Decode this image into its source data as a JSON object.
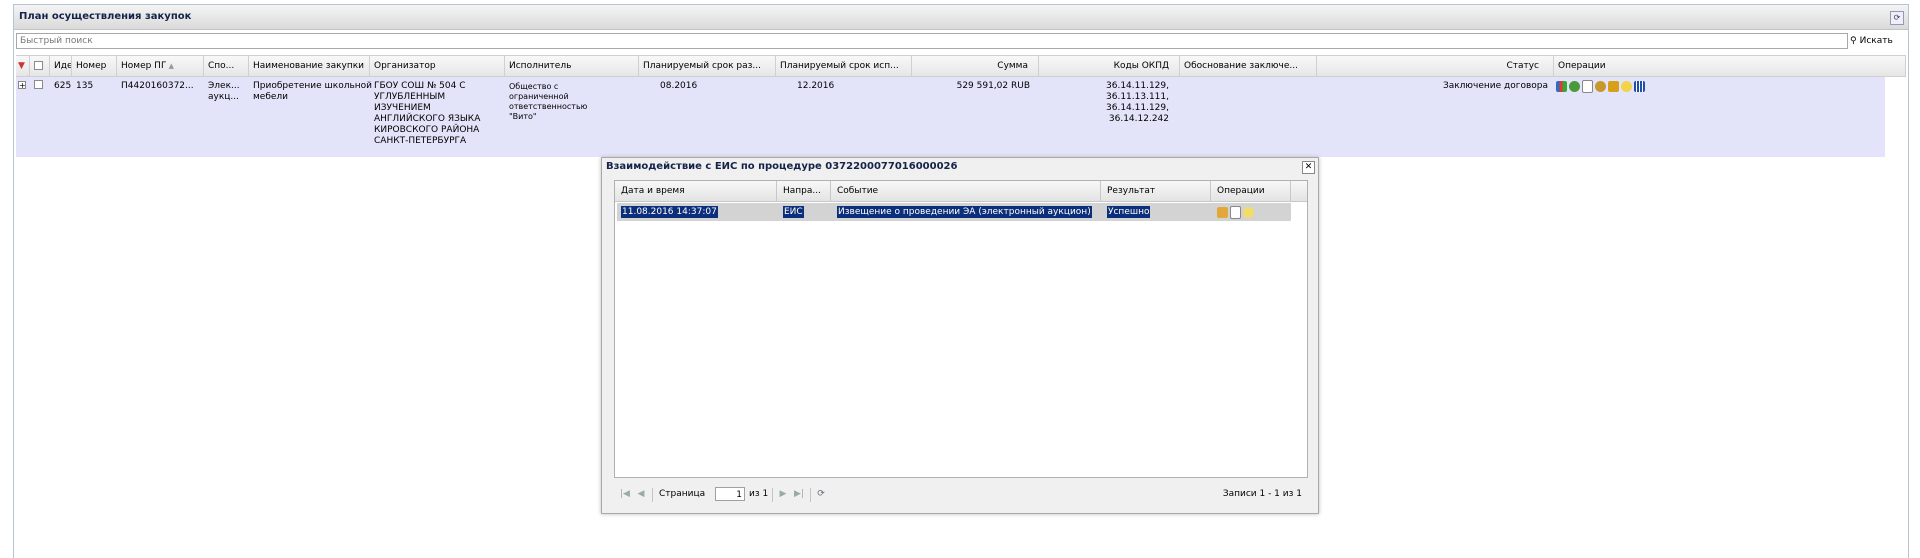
{
  "panel": {
    "title": "План осуществления закупок",
    "collapse_icon": "refresh-icon"
  },
  "search": {
    "placeholder": "Быстрый поиск",
    "button_label": "Искать",
    "icon": "binoculars-icon"
  },
  "grid": {
    "columns": [
      "Идє",
      "Номер",
      "Номер ПГ",
      "Спо...",
      "Наименование закупки",
      "Организатор",
      "Исполнитель",
      "Планируемый срок раз...",
      "Планируемый срок исп...",
      "Сумма",
      "Коды ОКПД",
      "Обоснование заключе...",
      "Статус",
      "Операции"
    ],
    "row": {
      "id": "625",
      "number": "135",
      "pg_number": "П4420160372...",
      "method_lines": [
        "Элек...",
        "аукц..."
      ],
      "name_lines": [
        "Приобретение школьной",
        "мебели"
      ],
      "organizer_lines": [
        "ГБОУ СОШ № 504 С",
        "УГЛУБЛЕННЫМ",
        "ИЗУЧЕНИЕМ",
        "АНГЛИЙСКОГО ЯЗЫКА",
        "КИРОВСКОГО РАЙОНА",
        "САНКТ-ПЕТЕРБУРГА"
      ],
      "executor_lines": [
        "Общество с",
        "ограниченной",
        "ответственностью",
        "\"Вито\""
      ],
      "planned_start": "08.2016",
      "planned_end": "12.2016",
      "sum": "529 591,02 RUB",
      "okpd_lines": [
        "36.14.11.129,",
        "36.11.13.111,",
        "36.14.11.129,",
        "36.14.12.242"
      ],
      "status": "Заключение договора"
    }
  },
  "dialog": {
    "title": "Взаимодействие с ЕИС по процедуре 0372200077016000026",
    "columns": [
      "Дата и время",
      "Напра...",
      "Событие",
      "Результат",
      "Операции"
    ],
    "row": {
      "datetime": "11.08.2016 14:37:07",
      "direction": "ЕИС",
      "event": "Извещение о проведении ЭА (электронный аукцион)",
      "result": "Успешно"
    },
    "pager": {
      "page_label": "Страница",
      "page_value": "1",
      "of_label": "из 1",
      "records_label": "Записи 1 - 1 из 1"
    }
  }
}
